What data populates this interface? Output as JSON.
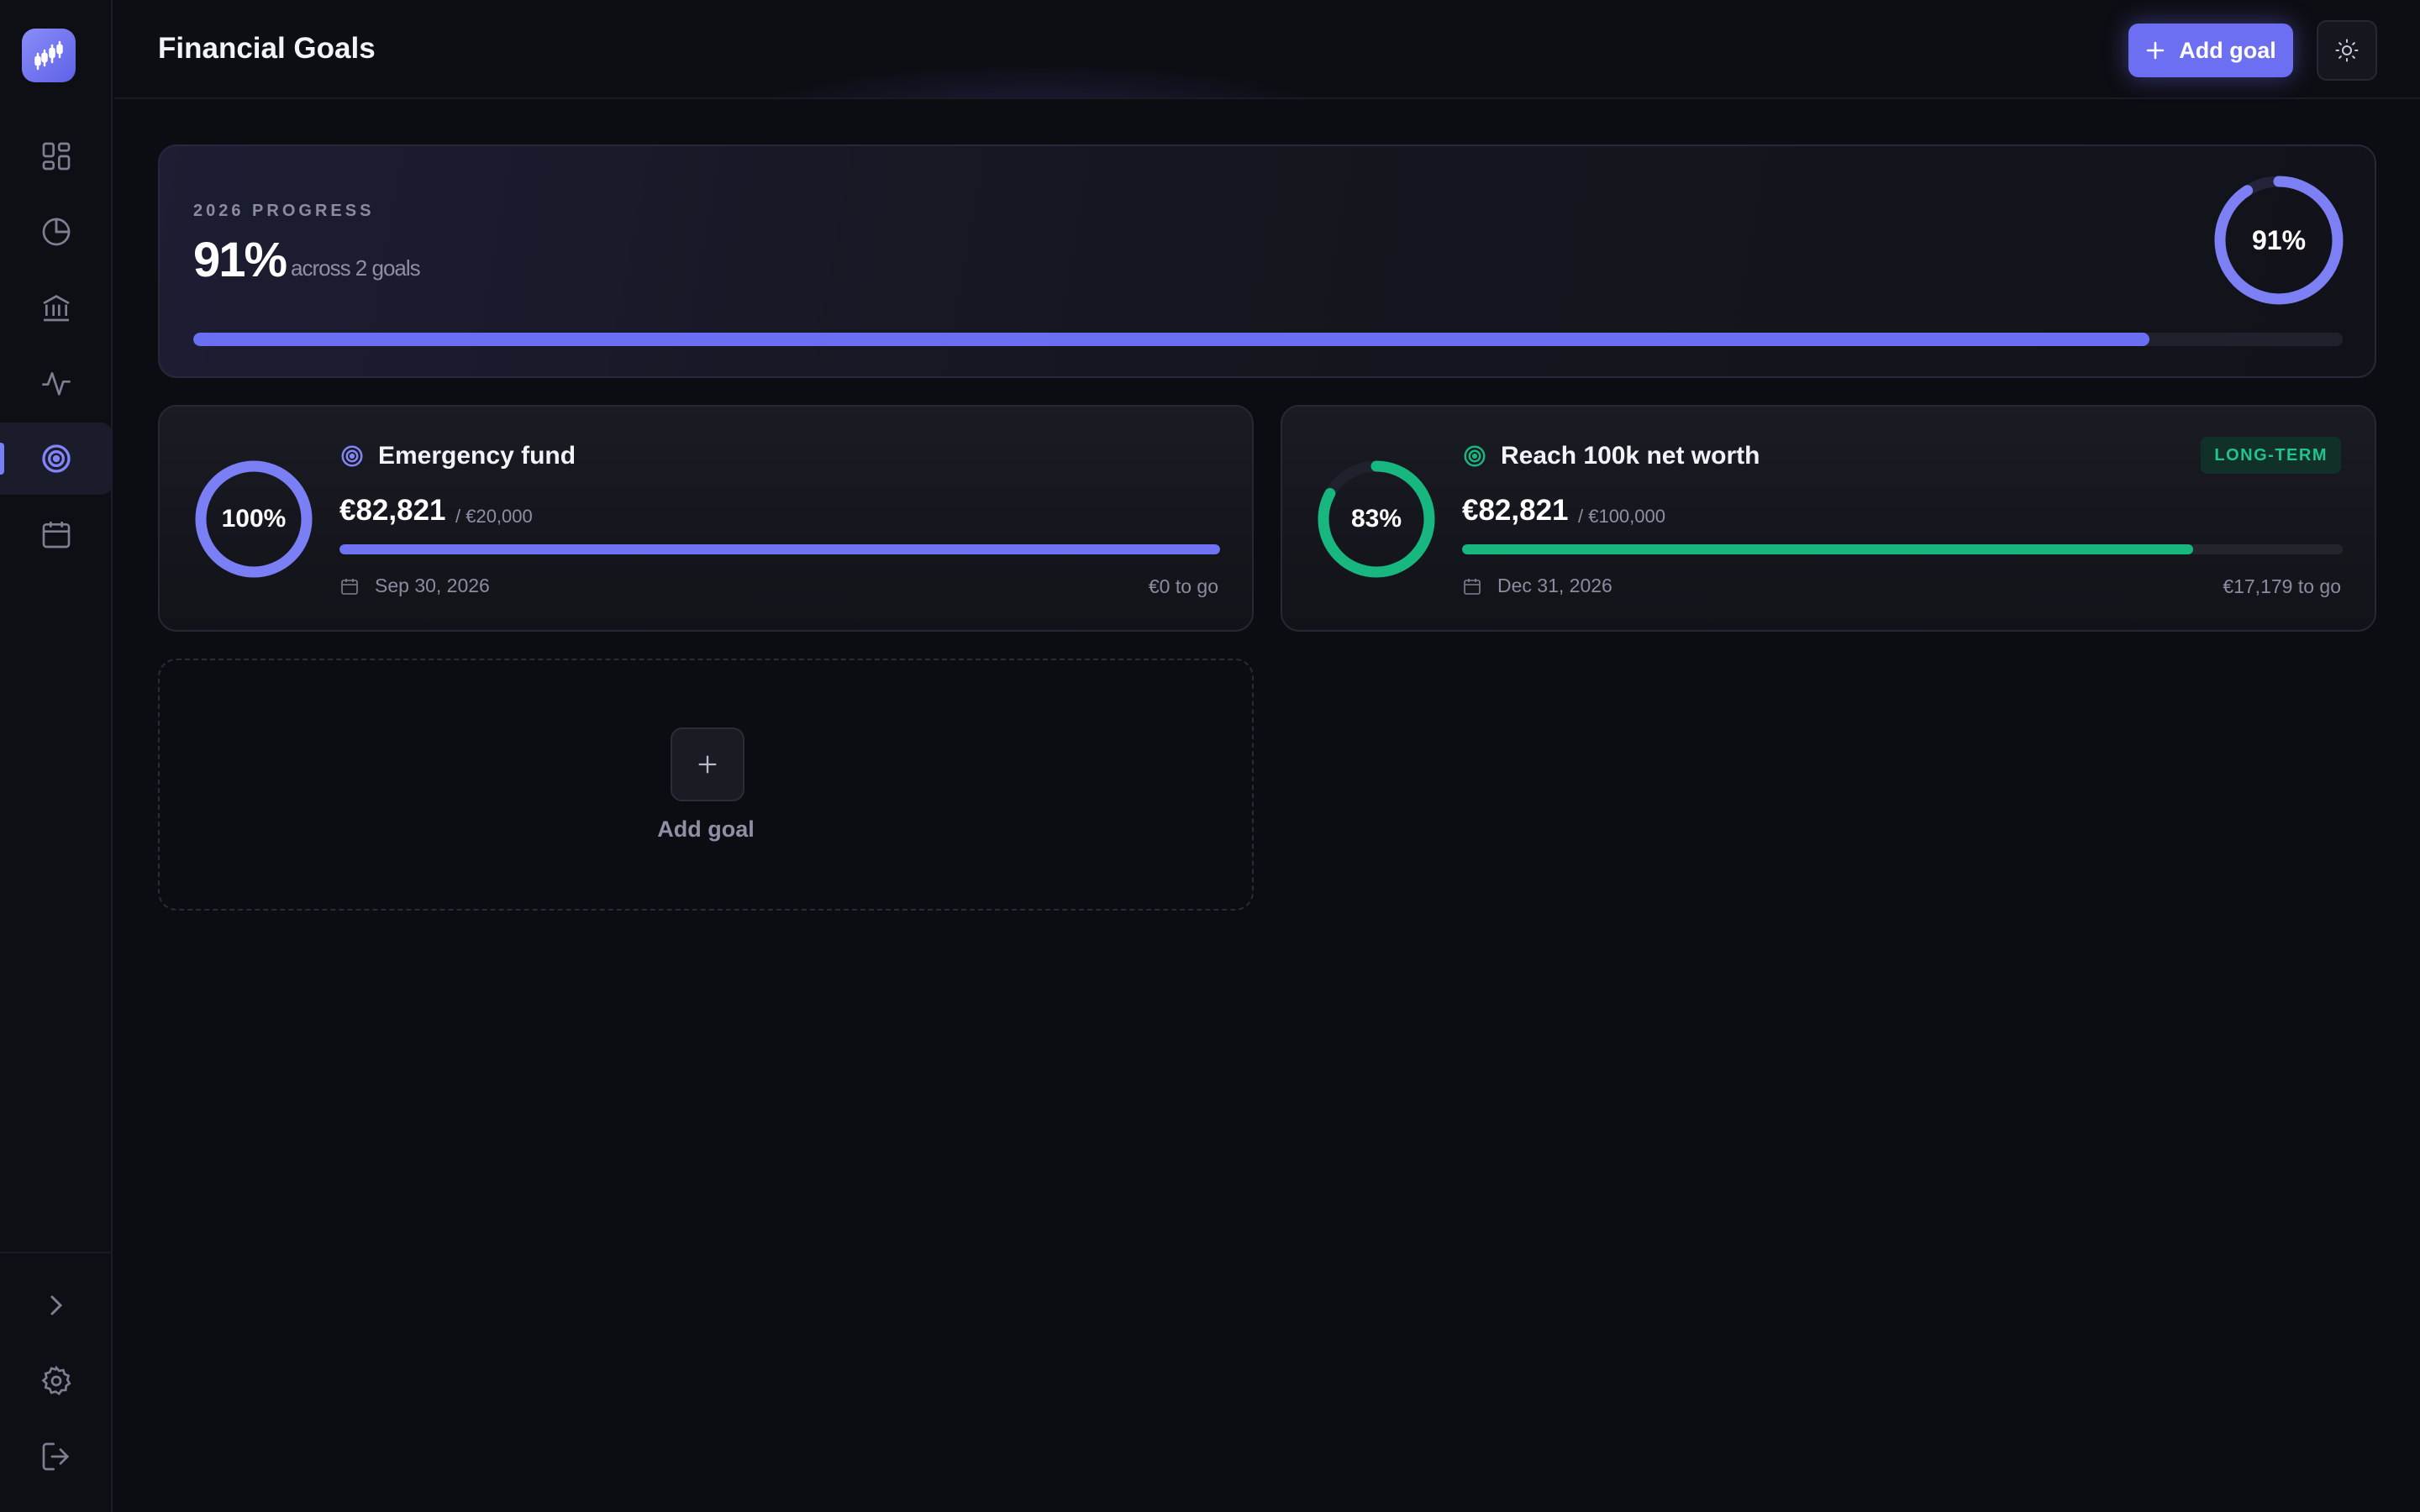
{
  "header": {
    "title": "Financial Goals",
    "add_goal_label": "Add goal"
  },
  "sidebar": {
    "items": [
      {
        "name": "dashboard",
        "icon": "grid-icon"
      },
      {
        "name": "analytics",
        "icon": "pie-chart-icon"
      },
      {
        "name": "accounts",
        "icon": "bank-icon"
      },
      {
        "name": "activity",
        "icon": "activity-icon"
      },
      {
        "name": "goals",
        "icon": "target-icon",
        "active": true
      },
      {
        "name": "calendar",
        "icon": "calendar-icon"
      }
    ],
    "bottom": [
      "chevron-right-icon",
      "settings-icon",
      "logout-icon"
    ]
  },
  "summary": {
    "label": "2026 PROGRESS",
    "percent_text": "91%",
    "sub": "across 2 goals",
    "progress": 0.91,
    "ring_text": "91%",
    "color": "#7d80f5"
  },
  "goals": [
    {
      "name": "Emergency fund",
      "amount": "€82,821",
      "target": "/ €20,000",
      "date": "Sep 30, 2026",
      "remaining": "€0 to go",
      "progress": 1.0,
      "ring_text": "100%",
      "color": "#7b7ff5",
      "fill_color": "#6e72f3"
    },
    {
      "name": "Reach 100k net worth",
      "amount": "€82,821",
      "target": "/ €100,000",
      "date": "Dec 31, 2026",
      "remaining": "€17,179 to go",
      "progress": 0.83,
      "ring_text": "83%",
      "badge": "LONG-TERM",
      "color": "#17b77f",
      "fill_color": "#17b77f"
    }
  ],
  "add_card": {
    "label": "Add goal"
  }
}
